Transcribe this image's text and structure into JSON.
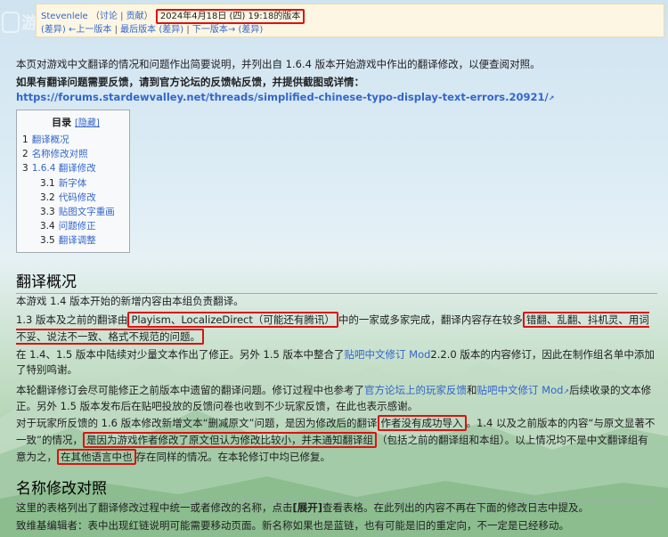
{
  "revision": {
    "author": "Stevenlele",
    "talk": "讨论",
    "contribs": "贡献",
    "date": "2024年4月18日 (四) 19:18的版本",
    "diff": "(差异)",
    "prev": "←上一版本",
    "sep1": "|",
    "latest": "最后版本",
    "latest_diff": "(差异)",
    "sep2": "|",
    "next": "下一版本→",
    "next_diff": "(差异)"
  },
  "watermark": {
    "text": "游研社"
  },
  "intro": "本页对游戏中文翻译的情况和问题作出简要说明，并列出自 1.6.4 版本开始游戏中作出的翻译修改，以便查阅对照。",
  "feedback": {
    "text": "如果有翻译问题需要反馈，请到官方论坛的反馈帖反馈，并提供截图或详情：",
    "url": "https://forums.stardewvalley.net/threads/simplified-chinese-typo-display-text-errors.20921/"
  },
  "toc": {
    "title": "目录",
    "hide": "[隐藏]",
    "items": [
      {
        "num": "1",
        "label": "翻译概况",
        "sub": false
      },
      {
        "num": "2",
        "label": "名称修改对照",
        "sub": false
      },
      {
        "num": "3",
        "label": "1.6.4 翻译修改",
        "sub": false
      },
      {
        "num": "3.1",
        "label": "新字体",
        "sub": true
      },
      {
        "num": "3.2",
        "label": "代码修改",
        "sub": true
      },
      {
        "num": "3.3",
        "label": "贴图文字重画",
        "sub": true
      },
      {
        "num": "3.4",
        "label": "问题修正",
        "sub": true
      },
      {
        "num": "3.5",
        "label": "翻译调整",
        "sub": true
      }
    ]
  },
  "section1": {
    "heading": "翻译概况",
    "p1": "本游戏 1.4 版本开始的新增内容由本组负责翻译。",
    "p2a": "1.3 版本及之前的翻译由",
    "p2_box1": "Playism、LocalizeDirect（可能还有腾讯）",
    "p2b": "中的一家或多家完成，翻译内容存在较多",
    "p2_box2": "错翻、乱翻、抖机灵、用词不妥、说法不一致、格式不规范的问题。",
    "p3a": "在 1.4、1.5 版本中陆续对少量文本作出了修正。另外 1.5 版本中整合了",
    "p3_link": "贴吧中文修订 Mod",
    "p3b": "2.2.0 版本的内容修订，因此在制作组名单中添加了特别鸣谢。",
    "p4a": "本轮翻译修订会尽可能修正之前版本中遗留的翻译问题。修订过程中也参考了",
    "p4_link1": "官方论坛上的玩家反馈",
    "p4_and": "和",
    "p4_link2": "贴吧中文修订 Mod",
    "p4b": "后续收录的文本修正。另外 1.5 版本发布后在贴吧投放的反馈问卷也收到不少玩家反馈，在此也表示感谢。",
    "p5a": "对于玩家所反馈的 1.6 版本修改新增文本“删减原文”问题，是因为修改后的翻译",
    "p5_box1": "作者没有成功导入",
    "p5b": "。1.4 以及之前版本的内容“与原文显著不一致”的情况，",
    "p5_box2": "是因为游戏作者修改了原文但认为修改比较小，并未通知翻译组",
    "p5c": "（包括之前的翻译组和本组）。以上情况均不是中文翻译组有意为之，",
    "p5_box3": "在其他语言中也",
    "p5d": "存在同样的情况。在本轮修订中均已修复。"
  },
  "section2": {
    "heading": "名称修改对照",
    "p1a": "这里的表格列出了翻译修改过程中统一或者修改的名称，点击",
    "p1_bold": "[展开]",
    "p1b": "查看表格。在此列出的内容不再在下面的修改日志中提及。",
    "p2": "致维基编辑者：表中出现红链说明可能需要移动页面。新名称如果也是蓝链，也有可能是旧的重定向，不一定是已经移动。"
  }
}
